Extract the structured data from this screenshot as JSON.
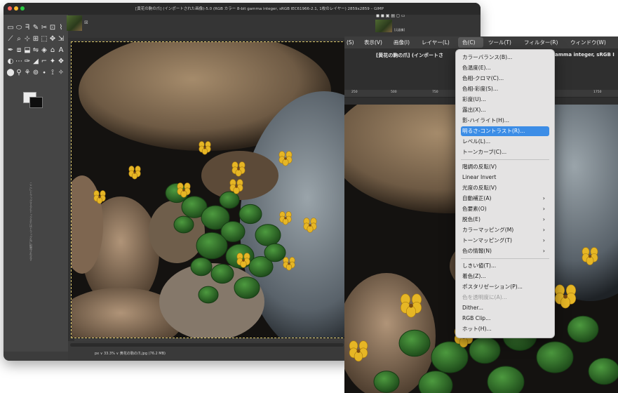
{
  "window1": {
    "title": "[黄花の駒の爪] (インポートされた画像)-5.0 (RGB カラー 8-bit gamma integer, sRGB IEC61966-2.1, 1枚のレイヤー) 2859x2859 – GIMP",
    "dock_label": "[元画像]",
    "status": "px ∨ 33.3% ∨ 黄花の駒の爪.jpg (76.2 MB)",
    "side_text": "ここにドラッグするとドックまたはドラッグ先に配置されます"
  },
  "window2": {
    "menubar": {
      "items": [
        "(S)",
        "表示(V)",
        "画像(I)",
        "レイヤー(L)",
        "色(C)",
        "ツール(T)",
        "フィルター(R)",
        "ウィンドウ(W)"
      ],
      "active": "色(C)"
    },
    "doc_title": "[黄花の駒の爪] (インポートさ",
    "doc_title_tail": "gamma integer, sRGB I",
    "ruler_labels": [
      "250",
      "500",
      "750",
      "1750"
    ]
  },
  "menu": {
    "items": [
      {
        "label": "カラーバランス(B)...",
        "submenu": false,
        "state": "normal"
      },
      {
        "label": "色温度(E)...",
        "submenu": false,
        "state": "normal"
      },
      {
        "label": "色相-クロマ(C)...",
        "submenu": false,
        "state": "normal"
      },
      {
        "label": "色相-彩度(S)...",
        "submenu": false,
        "state": "normal"
      },
      {
        "label": "彩度(U)...",
        "submenu": false,
        "state": "normal"
      },
      {
        "label": "露出(X)...",
        "submenu": false,
        "state": "normal"
      },
      {
        "label": "影-ハイライト(H)...",
        "submenu": false,
        "state": "normal"
      },
      {
        "label": "明るさ-コントラスト(R)...",
        "submenu": false,
        "state": "highlighted"
      },
      {
        "label": "レベル(L)...",
        "submenu": false,
        "state": "normal"
      },
      {
        "label": "トーンカーブ(C)...",
        "submenu": false,
        "state": "normal"
      },
      {
        "label": "階調の反転(V)",
        "submenu": false,
        "state": "normal"
      },
      {
        "label": "Linear Invert",
        "submenu": false,
        "state": "normal"
      },
      {
        "label": "光度の反転(V)",
        "submenu": false,
        "state": "normal"
      },
      {
        "label": "自動補正(A)",
        "submenu": true,
        "state": "normal"
      },
      {
        "label": "色要素(O)",
        "submenu": true,
        "state": "normal"
      },
      {
        "label": "脱色(E)",
        "submenu": true,
        "state": "normal"
      },
      {
        "label": "カラーマッピング(M)",
        "submenu": true,
        "state": "normal"
      },
      {
        "label": "トーンマッピング(T)",
        "submenu": true,
        "state": "normal"
      },
      {
        "label": "色の情報(N)",
        "submenu": true,
        "state": "normal"
      },
      {
        "label": "しきい値(T)...",
        "submenu": false,
        "state": "normal"
      },
      {
        "label": "着色(Z)...",
        "submenu": false,
        "state": "normal"
      },
      {
        "label": "ポスタリゼーション(P)...",
        "submenu": false,
        "state": "normal"
      },
      {
        "label": "色を透明度に(A)...",
        "submenu": false,
        "state": "disabled"
      },
      {
        "label": "Dither...",
        "submenu": false,
        "state": "normal"
      },
      {
        "label": "RGB Clip...",
        "submenu": false,
        "state": "normal"
      },
      {
        "label": "ホット(H)...",
        "submenu": false,
        "state": "normal"
      }
    ],
    "submenu_arrow": "›"
  },
  "colors": {
    "highlight": "#3c8de6",
    "menu_bg": "#e4e3e3",
    "dark_ui": "#3c3c3c"
  },
  "icons": [
    "close-icon",
    "minimize-icon",
    "zoom-icon",
    "tool-icons",
    "foreground-color-icon",
    "background-color-icon"
  ]
}
